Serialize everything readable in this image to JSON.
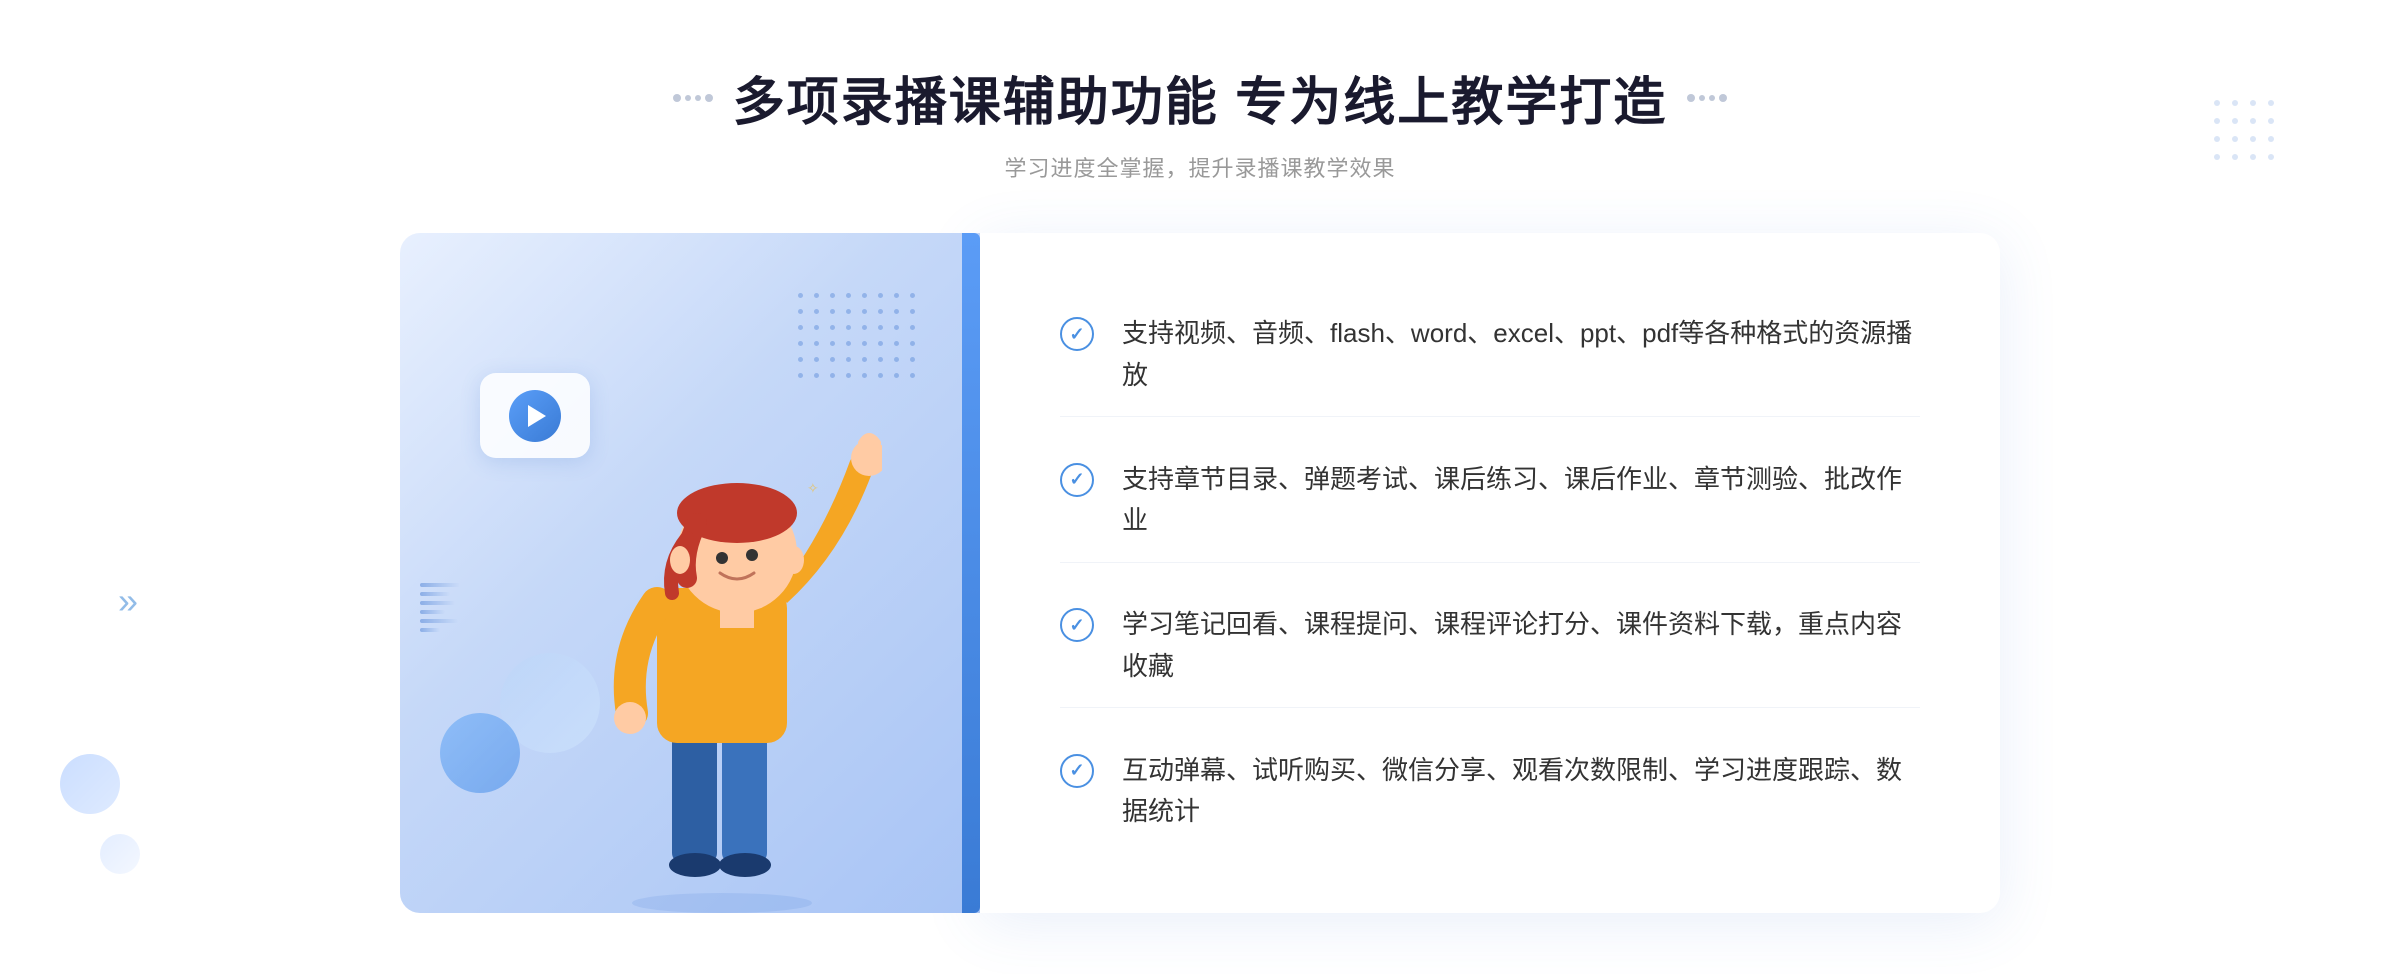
{
  "page": {
    "background": "#ffffff"
  },
  "header": {
    "title": "多项录播课辅助功能 专为线上教学打造",
    "subtitle": "学习进度全掌握，提升录播课教学效果"
  },
  "features": [
    {
      "id": 1,
      "text": "支持视频、音频、flash、word、excel、ppt、pdf等各种格式的资源播放"
    },
    {
      "id": 2,
      "text": "支持章节目录、弹题考试、课后练习、课后作业、章节测验、批改作业"
    },
    {
      "id": 3,
      "text": "学习笔记回看、课程提问、课程评论打分、课件资料下载，重点内容收藏"
    },
    {
      "id": 4,
      "text": "互动弹幕、试听购买、微信分享、观看次数限制、学习进度跟踪、数据统计"
    }
  ],
  "decorations": {
    "chevron_left": "»",
    "play_button_alt": "播放"
  }
}
